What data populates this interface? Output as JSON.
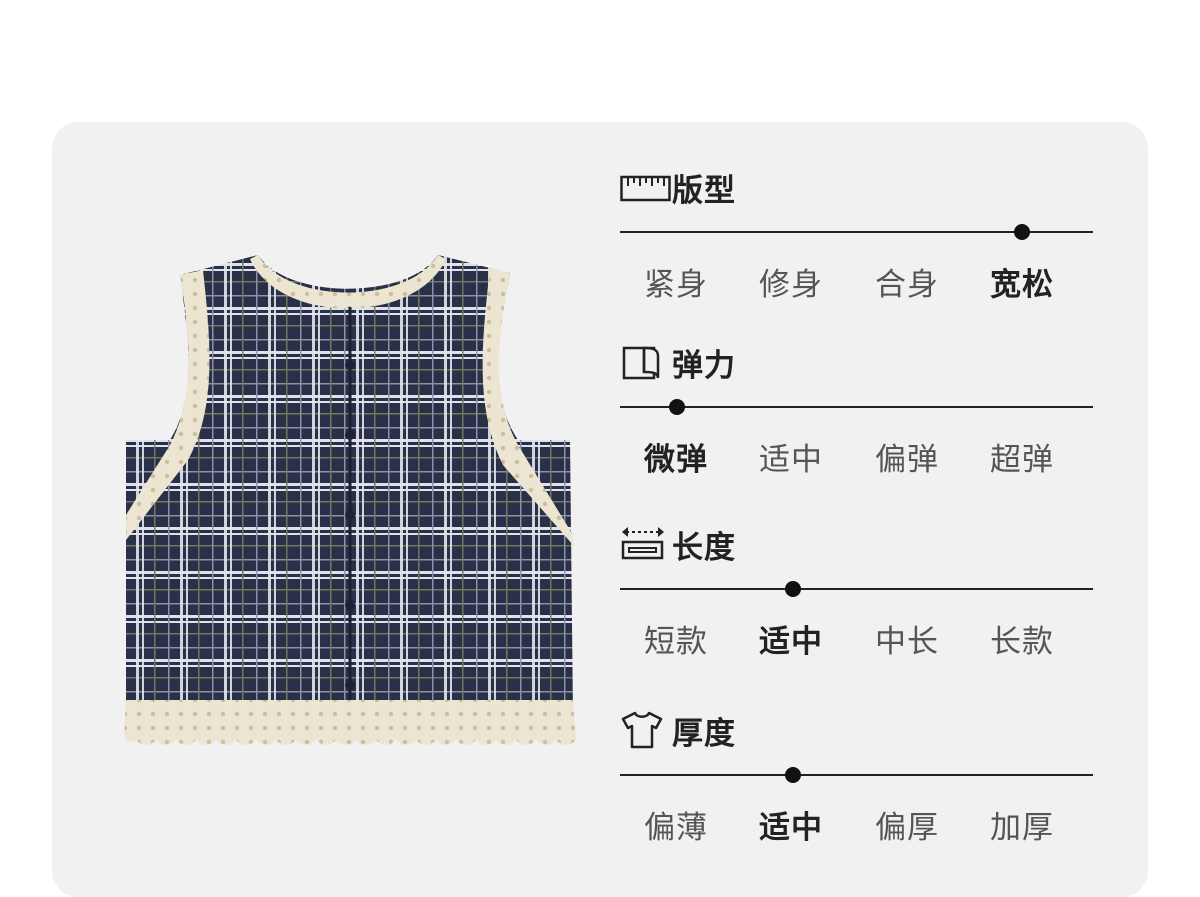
{
  "attributes": [
    {
      "key": "fit",
      "title": "版型",
      "icon": "ruler-icon",
      "options": [
        "紧身",
        "修身",
        "合身",
        "宽松"
      ],
      "selected": 3,
      "level": 0.85
    },
    {
      "key": "elasticity",
      "title": "弹力",
      "icon": "fabric-roll-icon",
      "options": [
        "微弹",
        "适中",
        "偏弹",
        "超弹"
      ],
      "selected": 0,
      "level": 0.12
    },
    {
      "key": "length",
      "title": "长度",
      "icon": "length-arrows-icon",
      "options": [
        "短款",
        "适中",
        "中长",
        "长款"
      ],
      "selected": 1,
      "level": 0.365
    },
    {
      "key": "thickness",
      "title": "厚度",
      "icon": "tshirt-icon",
      "options": [
        "偏薄",
        "适中",
        "偏厚",
        "加厚"
      ],
      "selected": 1,
      "level": 0.365
    }
  ],
  "colors": {
    "card": "#f1f1f1",
    "track": "#222222",
    "selected_text": "#222222",
    "option_text": "#555555",
    "plaid_navy": "#2a3047",
    "lace": "#e9e1cc"
  }
}
